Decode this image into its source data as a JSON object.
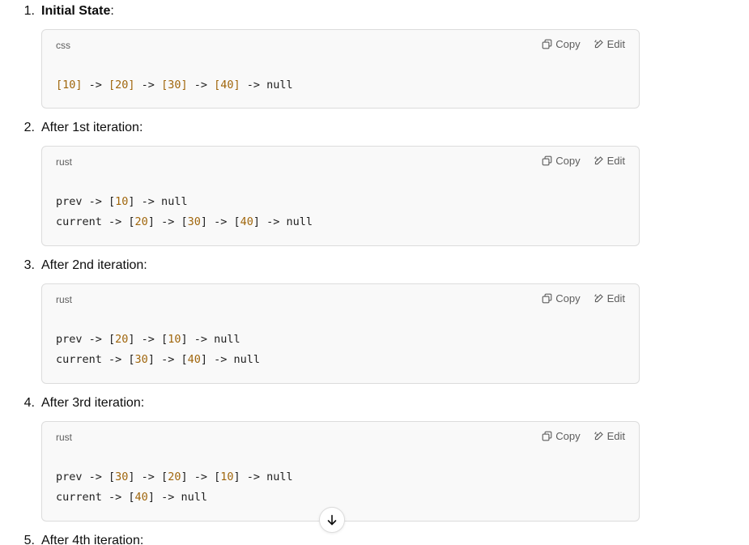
{
  "actions": {
    "copy_label": "Copy",
    "edit_label": "Edit",
    "copy_icon": "copy-icon",
    "edit_icon": "edit-icon",
    "scroll_icon": "arrow-down-icon"
  },
  "colors": {
    "number_token": "#a0660c",
    "code_bg": "#f9f9f9",
    "border": "#dcdcdc"
  },
  "steps": [
    {
      "number": "1.",
      "label": "Initial State",
      "colon": ":",
      "lang": "css",
      "lines": [
        [
          [
            "n",
            "[10]"
          ],
          [
            "t",
            " -> "
          ],
          [
            "n",
            "[20]"
          ],
          [
            "t",
            " -> "
          ],
          [
            "n",
            "[30]"
          ],
          [
            "t",
            " -> "
          ],
          [
            "n",
            "[40]"
          ],
          [
            "t",
            " -> null"
          ]
        ]
      ]
    },
    {
      "number": "2.",
      "label": "After 1st iteration",
      "colon": ":",
      "lang": "rust",
      "lines": [
        [
          [
            "t",
            "prev -> ["
          ],
          [
            "n",
            "10"
          ],
          [
            "t",
            "] -> null"
          ]
        ],
        [
          [
            "t",
            "current -> ["
          ],
          [
            "n",
            "20"
          ],
          [
            "t",
            "] -> ["
          ],
          [
            "n",
            "30"
          ],
          [
            "t",
            "] -> ["
          ],
          [
            "n",
            "40"
          ],
          [
            "t",
            "] -> null"
          ]
        ]
      ]
    },
    {
      "number": "3.",
      "label": "After 2nd iteration",
      "colon": ":",
      "lang": "rust",
      "lines": [
        [
          [
            "t",
            "prev -> ["
          ],
          [
            "n",
            "20"
          ],
          [
            "t",
            "] -> ["
          ],
          [
            "n",
            "10"
          ],
          [
            "t",
            "] -> null"
          ]
        ],
        [
          [
            "t",
            "current -> ["
          ],
          [
            "n",
            "30"
          ],
          [
            "t",
            "] -> ["
          ],
          [
            "n",
            "40"
          ],
          [
            "t",
            "] -> null"
          ]
        ]
      ]
    },
    {
      "number": "4.",
      "label": "After 3rd iteration",
      "colon": ":",
      "lang": "rust",
      "lines": [
        [
          [
            "t",
            "prev -> ["
          ],
          [
            "n",
            "30"
          ],
          [
            "t",
            "] -> ["
          ],
          [
            "n",
            "20"
          ],
          [
            "t",
            "] -> ["
          ],
          [
            "n",
            "10"
          ],
          [
            "t",
            "] -> null"
          ]
        ],
        [
          [
            "t",
            "current -> ["
          ],
          [
            "n",
            "40"
          ],
          [
            "t",
            "] -> null"
          ]
        ]
      ]
    },
    {
      "number": "5.",
      "label": "After 4th iteration",
      "colon": ":",
      "lang": "",
      "lines": []
    }
  ]
}
